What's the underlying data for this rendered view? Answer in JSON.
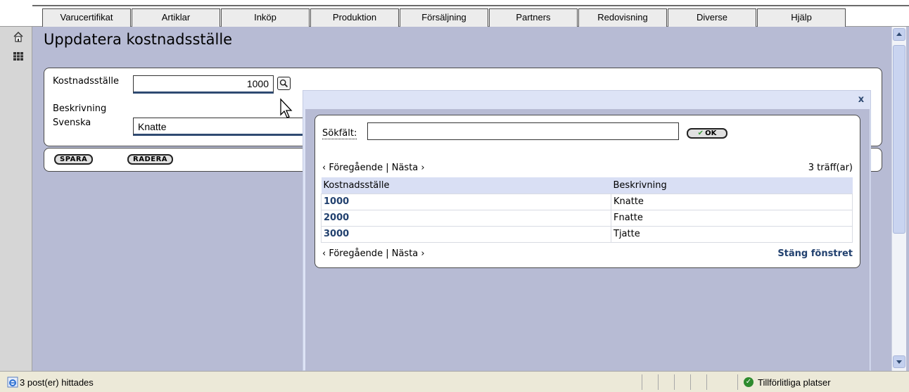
{
  "menu": [
    "Varucertifikat",
    "Artiklar",
    "Inköp",
    "Produktion",
    "Försäljning",
    "Partners",
    "Redovisning",
    "Diverse",
    "Hjälp"
  ],
  "page": {
    "title": "Uppdatera kostnadsställe"
  },
  "form": {
    "kostnadsstalle_label": "Kostnadsställe",
    "kostnadsstalle_value": "1000",
    "beskrivning_label": "Beskrivning",
    "svenska_label": "Svenska",
    "svenska_value": "Knatte"
  },
  "actions": {
    "save": "SPARA",
    "delete": "RADERA"
  },
  "popup": {
    "close": "x",
    "search_label": "Sökfält:",
    "search_value": "",
    "ok": "OK",
    "prev": "‹ Föregående",
    "sep": "|",
    "next": "Nästa ›",
    "hits": "3 träff(ar)",
    "columns": [
      "Kostnadsställe",
      "Beskrivning"
    ],
    "rows": [
      {
        "code": "1000",
        "desc": "Knatte"
      },
      {
        "code": "2000",
        "desc": "Fnatte"
      },
      {
        "code": "3000",
        "desc": "Tjatte"
      }
    ],
    "close_window": "Stäng fönstret"
  },
  "statusbar": {
    "text": "3 post(er) hittades",
    "zone": "Tillförlitliga platser"
  }
}
